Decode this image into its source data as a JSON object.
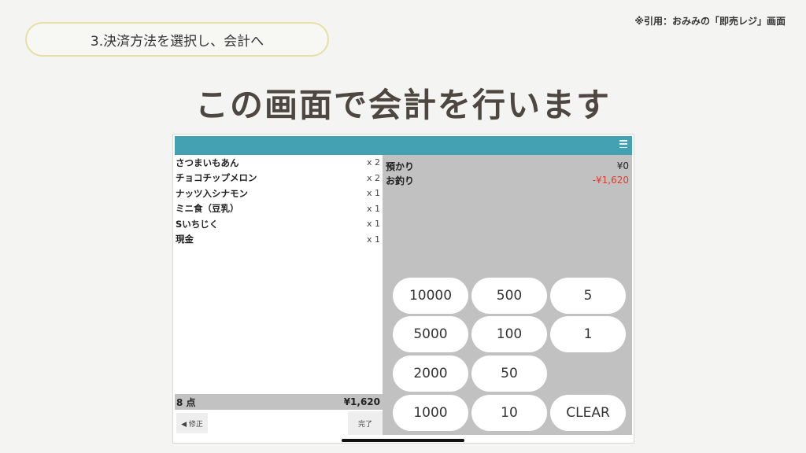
{
  "citation": "※引用：おみみの「即売レジ」画面",
  "step_label": "3.決済方法を選択し、会計へ",
  "headline": "この画面で会計を行います",
  "items": [
    {
      "name": "さつまいもあん",
      "qty": "x 2"
    },
    {
      "name": "チョコチップメロン",
      "qty": "x 2"
    },
    {
      "name": "ナッツ入シナモン",
      "qty": "x 1"
    },
    {
      "name": "ミニ食（豆乳）",
      "qty": "x 1"
    },
    {
      "name": "Sいちじく",
      "qty": "x 1"
    },
    {
      "name": "現金",
      "qty": "x 1"
    }
  ],
  "total": {
    "count": "8 点",
    "amount": "¥1,620"
  },
  "buttons": {
    "fix": "◀ 修正",
    "done": "完了"
  },
  "summary": {
    "deposit_label": "預かり",
    "deposit_value": "¥0",
    "change_label": "お釣り",
    "change_value": "-¥1,620"
  },
  "keypad": [
    "10000",
    "500",
    "5",
    "5000",
    "100",
    "1",
    "2000",
    "50",
    "1000",
    "10",
    "CLEAR"
  ],
  "colors": {
    "topbar": "#44a1b2",
    "negative": "#e23b2b",
    "pill_border": "#e6dfa6"
  }
}
